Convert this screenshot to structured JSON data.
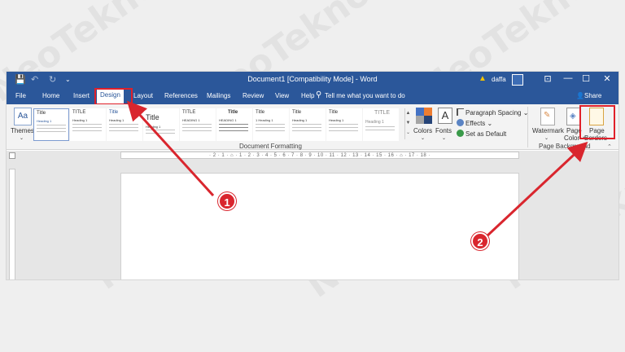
{
  "watermark_text": "NeoTekno",
  "title_bar": {
    "doc_title": "Document1 [Compatibility Mode] - Word",
    "user": "daffa",
    "minimize": "—",
    "restore": "☐",
    "maximize": "☐",
    "close": "✕"
  },
  "menu": {
    "file": "File",
    "home": "Home",
    "insert": "Insert",
    "design": "Design",
    "layout": "Layout",
    "references": "References",
    "mailings": "Mailings",
    "review": "Review",
    "view": "View",
    "help": "Help",
    "tell_me": "Tell me what you want to do",
    "share": "Share"
  },
  "ribbon": {
    "themes": "Themes",
    "style_thumbs": [
      {
        "title": "Title",
        "sub": "Heading 1"
      },
      {
        "title": "TITLE",
        "sub": "Heading 1"
      },
      {
        "title": "Title",
        "sub": "Heading 1"
      },
      {
        "title": "Title",
        "sub": "Heading 1"
      },
      {
        "title": "TITLE",
        "sub": "HEADING 1"
      },
      {
        "title": "Title",
        "sub": "HEADING 1"
      },
      {
        "title": "Title",
        "sub": "1 Heading 1"
      },
      {
        "title": "Title",
        "sub": "Heading 1"
      },
      {
        "title": "Title",
        "sub": "Heading 1"
      },
      {
        "title": "TITLE",
        "sub": "Heading 1"
      }
    ],
    "document_formatting": "Document Formatting",
    "colors": "Colors",
    "fonts": "Fonts",
    "paragraph_spacing": "Paragraph Spacing",
    "effects": "Effects",
    "set_as_default": "Set as Default",
    "watermark": "Watermark",
    "page_color_1": "Page",
    "page_color_2": "Color",
    "page_borders_1": "Page",
    "page_borders_2": "Borders",
    "page_background": "Page Background"
  },
  "ruler": "· 2 · 1 · ⌂ · 1 · 2 · 3 · 4 · 5 · 6 · 7 · 8 · 9 · 10 · 11 · 12 · 13 · 14 · 15 · 16 · ⌂ · 17 · 18 ·",
  "annotations": {
    "step1": "1",
    "step2": "2"
  },
  "colors": {
    "word_blue": "#2b579a",
    "highlight_red": "#e0202a"
  }
}
